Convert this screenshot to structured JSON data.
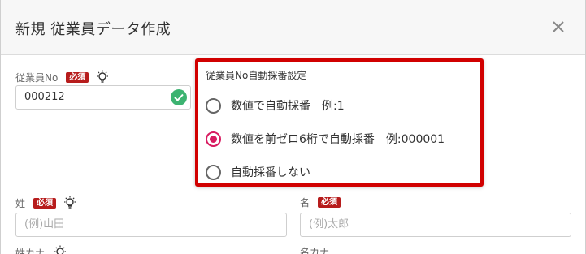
{
  "dialog": {
    "title": "新規 従業員データ作成"
  },
  "employee_no": {
    "label": "従業員No",
    "required_badge": "必須",
    "value": "000212"
  },
  "numbering_popover": {
    "title": "従業員No自動採番設定",
    "options": [
      {
        "label": "数値で自動採番　例:1",
        "selected": false
      },
      {
        "label": "数値を前ゼロ6桁で自動採番　例:000001",
        "selected": true
      },
      {
        "label": "自動採番しない",
        "selected": false
      }
    ]
  },
  "last_name": {
    "label": "姓",
    "required_badge": "必須",
    "placeholder": "(例)山田"
  },
  "first_name": {
    "label": "名",
    "required_badge": "必須",
    "placeholder": "(例)太郎"
  },
  "last_name_kana": {
    "label": "姓カナ"
  },
  "first_name_kana": {
    "label": "名カナ"
  },
  "colors": {
    "required_badge": "#b71c1c",
    "highlight_border": "#d10000",
    "radio_selected": "#d81b60",
    "valid_check": "#3cb371"
  }
}
